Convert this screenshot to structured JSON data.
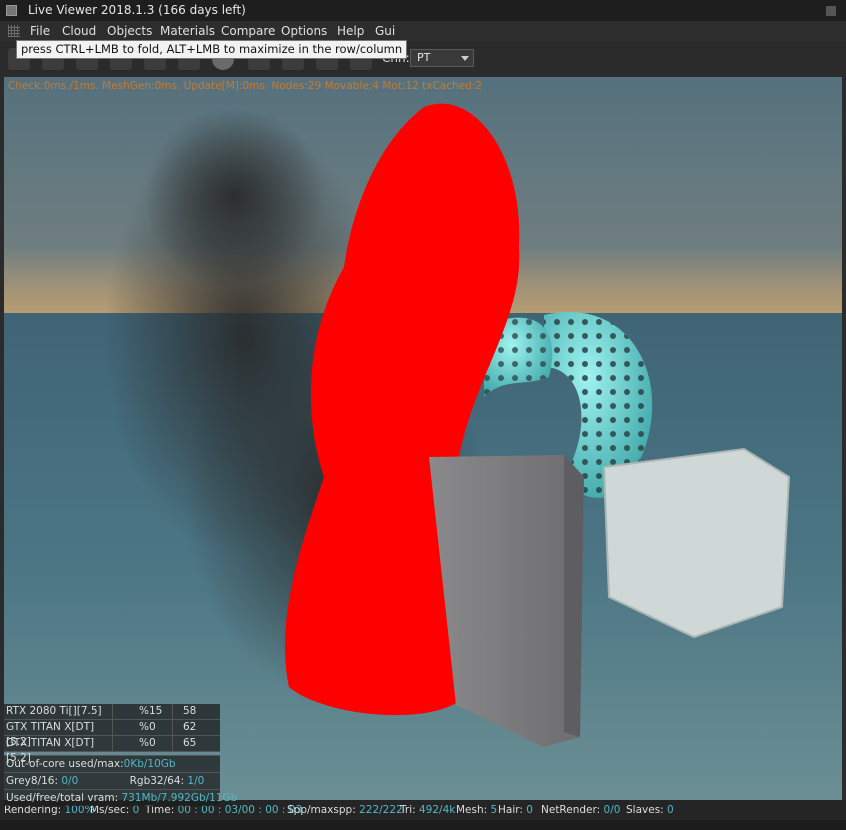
{
  "window": {
    "title": "Live Viewer 2018.1.3 (166 days left)"
  },
  "menu": [
    "File",
    "Cloud",
    "Objects",
    "Materials",
    "Compare",
    "Options",
    "Help",
    "Gui"
  ],
  "tooltip": "press CTRL+LMB to fold, ALT+LMB to maximize in the row/column",
  "toolbar": {
    "icons": [
      "lock-icon",
      "refresh-icon",
      "pause-icon",
      "clay-icon",
      "settings-icon",
      "stop-icon",
      "sphere-icon",
      "region-icon",
      "film-icon",
      "pick-icon",
      "focus-icon"
    ],
    "channel_label": "Chn:",
    "channel_value": "PT"
  },
  "render_stats": "Check:0ms./1ms. MeshGen:0ms. Update[M]:0ms. Nodes:29 Movable:4 Mot:12 txCached:2",
  "gpus": [
    {
      "name": "RTX 2080 Ti[][7.5]",
      "load": "%15",
      "temp": "58"
    },
    {
      "name": "GTX TITAN X[DT][5.2]",
      "load": "%0",
      "temp": "62"
    },
    {
      "name": "GTX TITAN X[DT][5.2]",
      "load": "%0",
      "temp": "65"
    }
  ],
  "memory": {
    "out_of_core_label": "Out-of-core used/max:",
    "out_of_core_value": "0Kb/10Gb",
    "grey_label": "Grey8/16:",
    "grey_value": "0/0",
    "rgb_label": "Rgb32/64:",
    "rgb_value": "1/0",
    "vram_label": "Used/free/total vram:",
    "vram_value": "731Mb/7.992Gb/11Gb"
  },
  "status": {
    "rendering_label": "Rendering:",
    "rendering_value": "100%",
    "mssec_label": "Ms/sec:",
    "mssec_value": "0",
    "time_label": "Time:",
    "time_value": "00 : 00 : 03/00 : 00 : 03",
    "spp_label": "Spp/maxspp:",
    "spp_value": "222/222",
    "tri_label": "Tri:",
    "tri_value": "492/4k",
    "mesh_label": "Mesh:",
    "mesh_value": "5",
    "hair_label": "Hair:",
    "hair_value": "0",
    "netrender_label": "NetRender:",
    "netrender_value": "0/0",
    "slaves_label": "Slaves:",
    "slaves_value": "0"
  },
  "colors": {
    "accent_value": "#4fb8c8",
    "stats_orange": "#c87a2e",
    "smoke_red": "#ff0000"
  }
}
